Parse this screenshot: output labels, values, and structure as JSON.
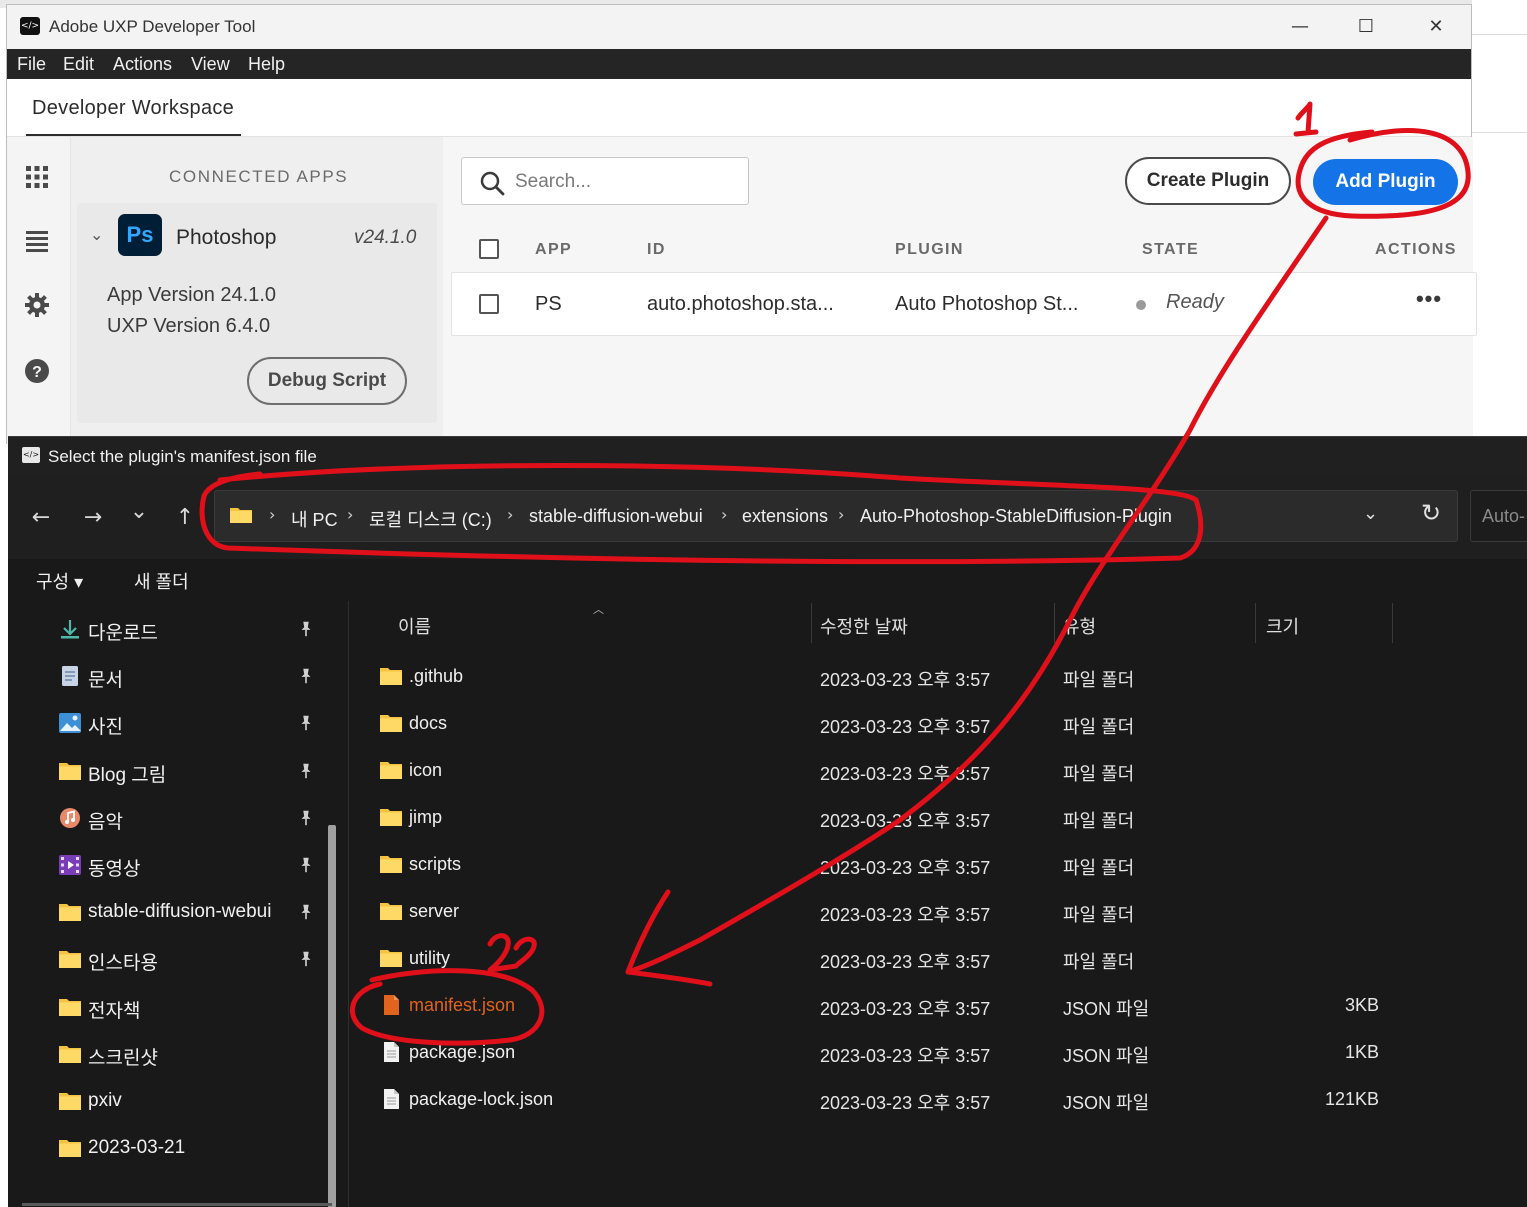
{
  "uxp": {
    "title": "Adobe UXP Developer Tool",
    "window_controls": {
      "minimize": "—",
      "maximize": "☐",
      "close": "✕"
    },
    "menu": [
      "File",
      "Edit",
      "Actions",
      "View",
      "Help"
    ],
    "tab": "Developer Workspace",
    "connected_apps_heading": "CONNECTED APPS",
    "app": {
      "logo": "Ps",
      "name": "Photoshop",
      "version": "v24.1.0",
      "app_version": "App Version 24.1.0",
      "uxp_version": "UXP Version 6.4.0",
      "debug_label": "Debug Script"
    },
    "search_placeholder": "Search...",
    "create_label": "Create Plugin",
    "add_label": "Add Plugin",
    "columns": {
      "app": "APP",
      "id": "ID",
      "plugin": "PLUGIN",
      "state": "STATE",
      "actions": "ACTIONS"
    },
    "row": {
      "app": "PS",
      "id": "auto.photoshop.sta...",
      "plugin": "Auto Photoshop St...",
      "state": "Ready",
      "more": "•••"
    },
    "rail_icons": [
      "grid-icon",
      "list-icon",
      "gear-icon",
      "help-icon"
    ]
  },
  "dialog": {
    "title": "Select the plugin's manifest.json file",
    "nav": {
      "back": "←",
      "forward": "→",
      "recent": "⌄",
      "up": "↑"
    },
    "breadcrumbs": [
      "내 PC",
      "로컬 디스크 (C:)",
      "stable-diffusion-webui",
      "extensions",
      "Auto-Photoshop-StableDiffusion-Plugin"
    ],
    "search_placeholder": "Auto-",
    "commands": {
      "organize": "구성 ▾",
      "new_folder": "새 폴더"
    },
    "nav_items": [
      {
        "label": "다운로드",
        "icon": "download-icon",
        "pinned": true
      },
      {
        "label": "문서",
        "icon": "document-icon",
        "pinned": true
      },
      {
        "label": "사진",
        "icon": "pictures-icon",
        "pinned": true
      },
      {
        "label": "Blog 그림",
        "icon": "folder-icon",
        "pinned": true
      },
      {
        "label": "음악",
        "icon": "music-icon",
        "pinned": true
      },
      {
        "label": "동영상",
        "icon": "video-icon",
        "pinned": true
      },
      {
        "label": "stable-diffusion-webui",
        "icon": "folder-icon",
        "pinned": true
      },
      {
        "label": "인스타용",
        "icon": "folder-icon",
        "pinned": true
      },
      {
        "label": "전자책",
        "icon": "folder-icon",
        "pinned": false
      },
      {
        "label": "스크린샷",
        "icon": "folder-icon",
        "pinned": false
      },
      {
        "label": "pxiv",
        "icon": "folder-icon",
        "pinned": false
      },
      {
        "label": "2023-03-21",
        "icon": "folder-icon",
        "pinned": false
      }
    ],
    "pin_glyph": "📌",
    "columns": {
      "name": "이름",
      "date": "수정한 날짜",
      "type": "유형",
      "size": "크기"
    },
    "files": [
      {
        "name": ".github",
        "date": "2023-03-23 오후 3:57",
        "type": "파일 폴더",
        "size": "",
        "icon": "folder-icon"
      },
      {
        "name": "docs",
        "date": "2023-03-23 오후 3:57",
        "type": "파일 폴더",
        "size": "",
        "icon": "folder-icon"
      },
      {
        "name": "icon",
        "date": "2023-03-23 오후 3:57",
        "type": "파일 폴더",
        "size": "",
        "icon": "folder-icon"
      },
      {
        "name": "jimp",
        "date": "2023-03-23 오후 3:57",
        "type": "파일 폴더",
        "size": "",
        "icon": "folder-icon"
      },
      {
        "name": "scripts",
        "date": "2023-03-23 오후 3:57",
        "type": "파일 폴더",
        "size": "",
        "icon": "folder-icon"
      },
      {
        "name": "server",
        "date": "2023-03-23 오후 3:57",
        "type": "파일 폴더",
        "size": "",
        "icon": "folder-icon"
      },
      {
        "name": "utility",
        "date": "2023-03-23 오후 3:57",
        "type": "파일 폴더",
        "size": "",
        "icon": "folder-icon"
      },
      {
        "name": "manifest.json",
        "date": "2023-03-23 오후 3:57",
        "type": "JSON 파일",
        "size": "3KB",
        "icon": "json-file-icon",
        "highlighted": true
      },
      {
        "name": "package.json",
        "date": "2023-03-23 오후 3:57",
        "type": "JSON 파일",
        "size": "1KB",
        "icon": "file-icon"
      },
      {
        "name": "package-lock.json",
        "date": "2023-03-23 오후 3:57",
        "type": "JSON 파일",
        "size": "121KB",
        "icon": "file-icon"
      }
    ]
  },
  "annotation": {
    "color": "#e0101a",
    "mark1": "1",
    "mark2": "2"
  },
  "colors": {
    "accent_blue": "#1473e6",
    "ps_dark": "#001e36",
    "ps_blue": "#31a8ff",
    "folder_yellow": "#f5c342",
    "highlight_orange": "#e0641e"
  }
}
